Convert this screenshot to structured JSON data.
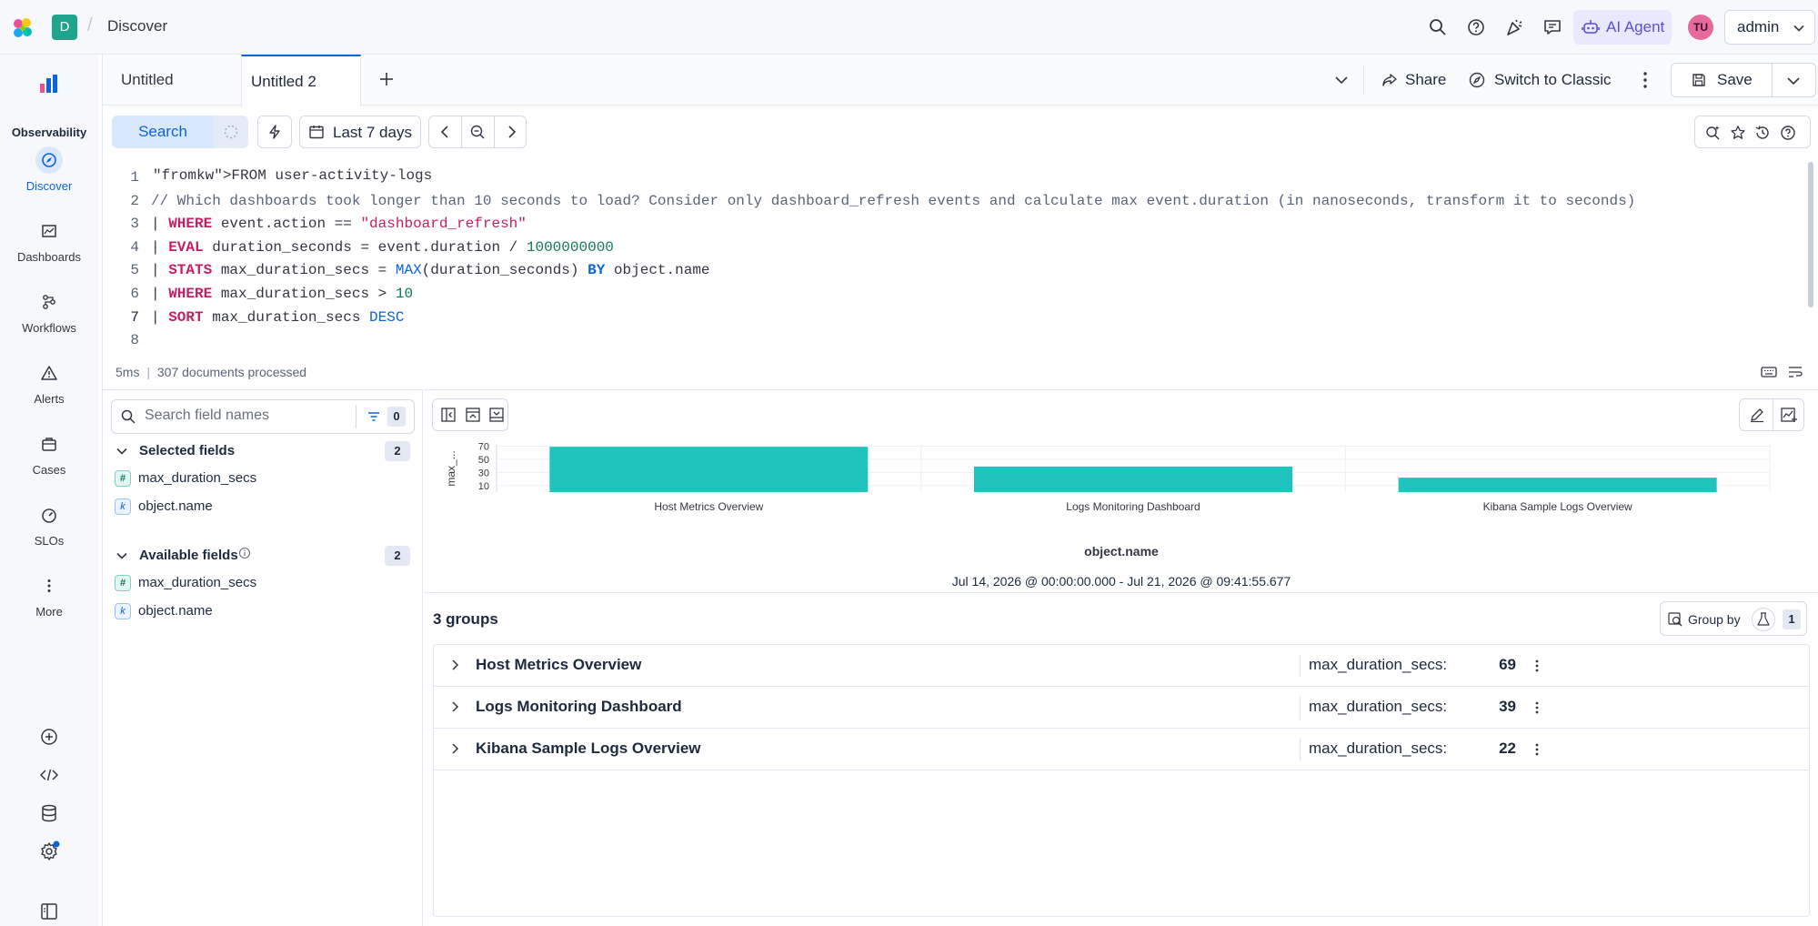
{
  "header": {
    "space_initial": "D",
    "breadcrumb": "Discover",
    "ai_agent_label": "AI Agent",
    "avatar_initials": "TU",
    "user_label": "admin"
  },
  "nav": {
    "solution": "Observability",
    "items": [
      {
        "label": "Discover",
        "icon": "discover-icon",
        "active": true
      },
      {
        "label": "Dashboards",
        "icon": "dashboards-icon"
      },
      {
        "label": "Workflows",
        "icon": "workflows-icon"
      },
      {
        "label": "Alerts",
        "icon": "alerts-icon"
      },
      {
        "label": "Cases",
        "icon": "cases-icon"
      },
      {
        "label": "SLOs",
        "icon": "slos-icon"
      },
      {
        "label": "More",
        "icon": "more-icon"
      }
    ]
  },
  "tabs": {
    "items": [
      "Untitled",
      "Untitled 2"
    ],
    "active_index": 1,
    "share_label": "Share",
    "switch_label": "Switch to Classic",
    "save_label": "Save"
  },
  "query": {
    "search_label": "Search",
    "time_range": "Last 7 days",
    "lines": [
      "FROM user-activity-logs",
      "// Which dashboards took longer than 10 seconds to load? Consider only dashboard_refresh events and calculate max event.duration (in nanoseconds, transform it to seconds)",
      "| WHERE event.action == \"dashboard_refresh\"",
      "| EVAL duration_seconds = event.duration / 1000000000",
      "| STATS max_duration_secs = MAX(duration_seconds) BY object.name",
      "| WHERE max_duration_secs > 10",
      "| SORT max_duration_secs DESC",
      ""
    ],
    "line_numbers": [
      "1",
      "2",
      "3",
      "4",
      "5",
      "6",
      "7",
      "8"
    ],
    "status_time": "5ms",
    "status_docs": "307 documents processed"
  },
  "fields": {
    "search_placeholder": "Search field names",
    "filter_count": "0",
    "selected_title": "Selected fields",
    "selected_count": "2",
    "selected": [
      {
        "name": "max_duration_secs",
        "type": "#"
      },
      {
        "name": "object.name",
        "type": "k"
      }
    ],
    "available_title": "Available fields",
    "available_count": "2",
    "available": [
      {
        "name": "max_duration_secs",
        "type": "#"
      },
      {
        "name": "object.name",
        "type": "k"
      }
    ]
  },
  "chart_data": {
    "type": "bar",
    "categories": [
      "Host Metrics Overview",
      "Logs Monitoring Dashboard",
      "Kibana Sample Logs Overview"
    ],
    "values": [
      69,
      39,
      22
    ],
    "xlabel": "object.name",
    "ylabel": "max_...",
    "yticks": [
      10,
      30,
      50,
      70
    ],
    "ylim": [
      0,
      72
    ],
    "color": "#20c4be",
    "time_range_label": "Jul 14, 2026 @ 00:00:00.000 - Jul 21, 2026 @ 09:41:55.677"
  },
  "groups": {
    "count_label": "3 groups",
    "group_by_label": "Group by",
    "group_by_count": "1",
    "rows": [
      {
        "name": "Host Metrics Overview",
        "key": "max_duration_secs:",
        "value": "69"
      },
      {
        "name": "Logs Monitoring Dashboard",
        "key": "max_duration_secs:",
        "value": "39"
      },
      {
        "name": "Kibana Sample Logs Overview",
        "key": "max_duration_secs:",
        "value": "22"
      }
    ]
  }
}
